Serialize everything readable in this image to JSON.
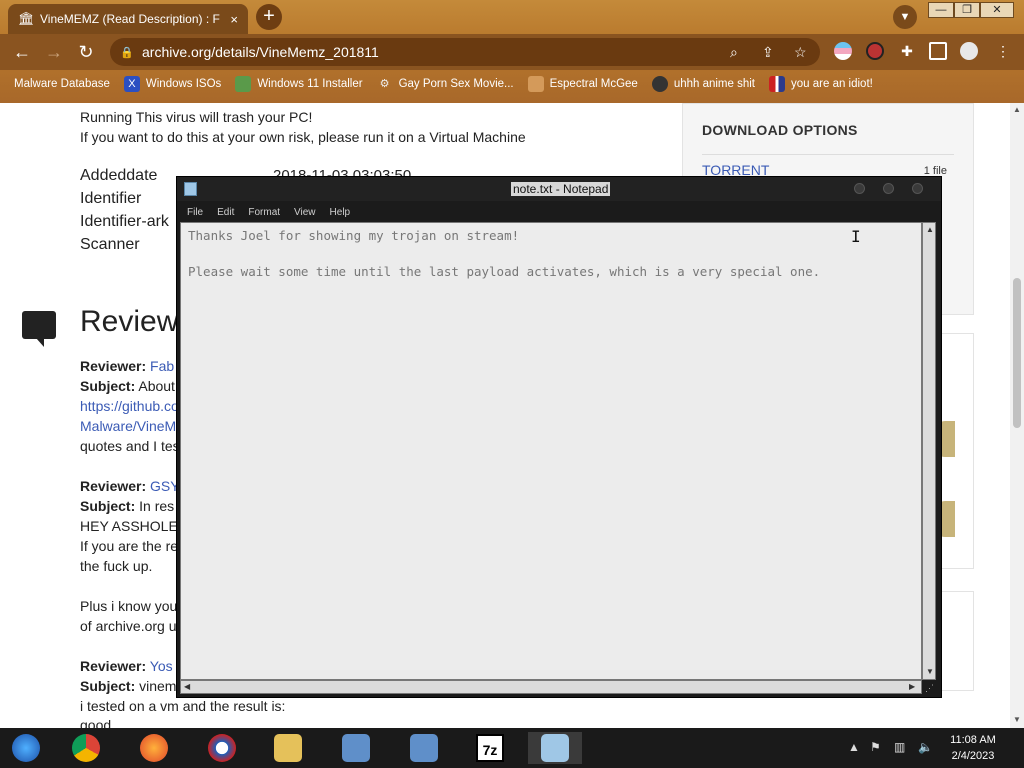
{
  "browser": {
    "tab_title": "VineMEMZ (Read Description) : F",
    "tab_close": "×",
    "new_tab": "+",
    "url": "archive.org/details/VineMemz_201811",
    "bookmarks": [
      {
        "label": "Malware Database",
        "icon": "malware-db-icon"
      },
      {
        "label": "Windows ISOs",
        "icon": "x-icon"
      },
      {
        "label": "Windows 11 Installer",
        "icon": "image-icon"
      },
      {
        "label": "Gay Porn Sex Movie...",
        "icon": "gear-icon"
      },
      {
        "label": "Espectral McGee",
        "icon": "face-icon"
      },
      {
        "label": "uhhh anime shit",
        "icon": "anime-icon"
      },
      {
        "label": "you are an idiot!",
        "icon": "flag-icon"
      }
    ]
  },
  "page": {
    "warning_line1": "Running This virus will trash your PC!",
    "warning_line2": "If you want to do this at your own risk, please run it on a Virtual Machine",
    "metadata": [
      {
        "key": "Addeddate",
        "value": "2018-11-03 03:03:50"
      },
      {
        "key": "Identifier",
        "value": ""
      },
      {
        "key": "Identifier-ark",
        "value": ""
      },
      {
        "key": "Scanner",
        "value": ""
      }
    ],
    "reviews_heading": "Review",
    "reviews": [
      {
        "reviewer_label": "Reviewer:",
        "reviewer": "Fab",
        "subject_label": "Subject:",
        "subject": "About",
        "lines": [
          "https://github.co",
          "Malware/VineM",
          "quotes and I tes"
        ]
      },
      {
        "reviewer_label": "Reviewer:",
        "reviewer": "GSY",
        "subject_label": "Subject:",
        "subject": "In res",
        "lines": [
          "HEY ASSHOLE",
          "If you are the re",
          "the fuck up.",
          "",
          "Plus i know you",
          "of archive.org u"
        ]
      },
      {
        "reviewer_label": "Reviewer:",
        "reviewer": "Yos",
        "subject_label": "Subject:",
        "subject": "vinem",
        "lines": [
          "i tested on a vm and the result is:",
          "good"
        ]
      }
    ],
    "download_options_title": "DOWNLOAD OPTIONS",
    "torrent_label": "TORRENT",
    "torrent_count": "1 file"
  },
  "notepad": {
    "title": "note.txt - Notepad",
    "menu": [
      "File",
      "Edit",
      "Format",
      "View",
      "Help"
    ],
    "line1": "Thanks Joel for showing my trojan on stream!",
    "line2": "Please wait some time until the last payload activates, which is a very special one."
  },
  "taskbar": {
    "sevenzip_label": "7z",
    "time": "11:08 AM",
    "date": "2/4/2023"
  },
  "colors": {
    "chrome_accent": "#b8782c",
    "link": "#3b5bb5",
    "taskbar": "#1a1a1a"
  }
}
